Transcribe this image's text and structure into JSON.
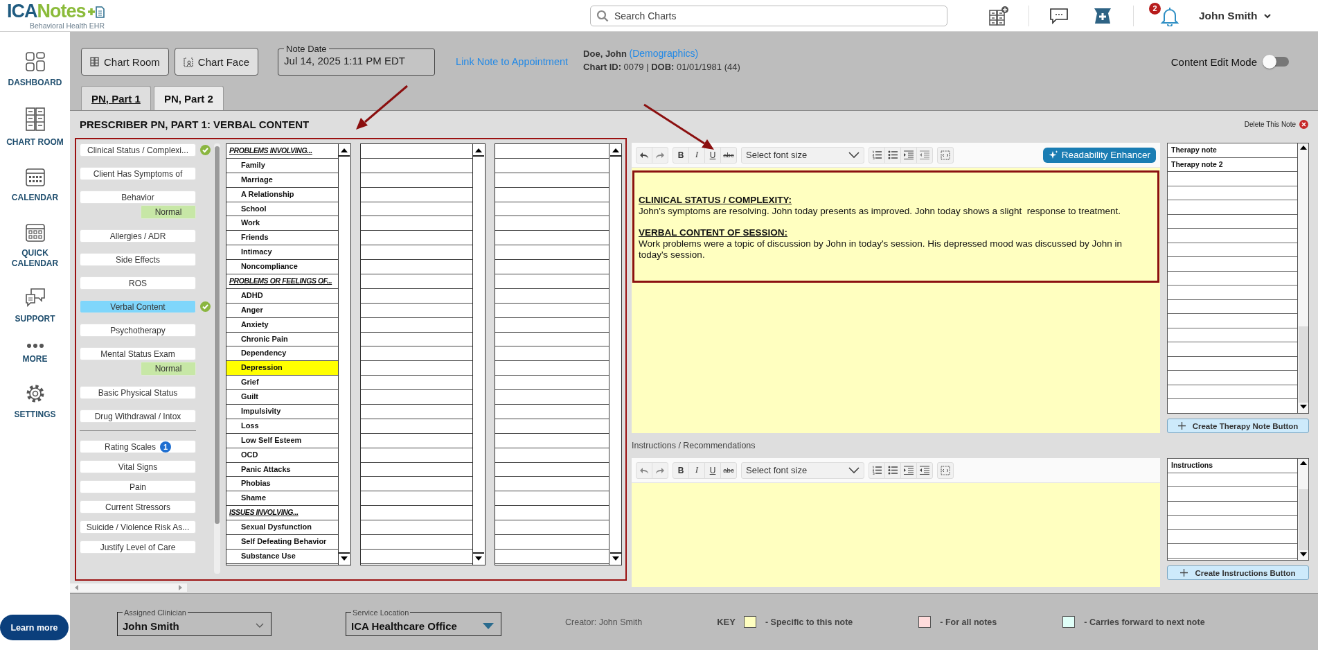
{
  "header": {
    "logo_part_1": "ICA",
    "logo_part_2": "Notes",
    "tagline": "Behavioral Health EHR",
    "search_placeholder": "Search Charts",
    "notification_count": "2",
    "user_name": "John Smith"
  },
  "nav": [
    {
      "label": "DASHBOARD",
      "kind": "dashboard"
    },
    {
      "label": "CHART ROOM",
      "kind": "chartroom"
    },
    {
      "label": "CALENDAR",
      "kind": "calendar"
    },
    {
      "label": "QUICK CALENDAR",
      "kind": "quickcalendar"
    },
    {
      "label": "SUPPORT",
      "kind": "support"
    },
    {
      "label": "MORE",
      "kind": "more"
    },
    {
      "label": "SETTINGS",
      "kind": "settings"
    }
  ],
  "learn_more": "Learn more",
  "toolbar": {
    "buttons": [
      {
        "label": "Chart Room",
        "kind": "chartroom"
      },
      {
        "label": "Chart Face",
        "kind": "chartface"
      }
    ],
    "note_date": {
      "label": "Note Date",
      "value": "Jul 14, 2025 1:11 PM EDT"
    },
    "link": "Link Note to Appointment",
    "patient": {
      "name": "Doe, John",
      "demographics": "(Demographics)",
      "chart_id_label": "Chart ID:",
      "chart_id": "0079",
      "separator": "|",
      "dob_label": "DOB:",
      "dob": "01/01/1981 (44)"
    },
    "content_edit_mode": {
      "label": "Content Edit Mode",
      "on": false
    }
  },
  "tabs": [
    {
      "label": "PN, Part 1",
      "selected": true
    },
    {
      "label": "PN, Part 2",
      "selected": false
    }
  ],
  "section_title": "PRESCRIBER PN, PART 1: VERBAL CONTENT",
  "delete_note": "Delete This Note",
  "sections": [
    {
      "label": "Clinical Status / Complexi...",
      "selected": false,
      "completed": true
    },
    {
      "label": "Client Has Symptoms of",
      "selected": false,
      "completed": false
    },
    {
      "label": "Behavior",
      "selected": false,
      "completed": false,
      "status": "Normal"
    },
    {
      "label": "Allergies / ADR",
      "selected": false,
      "completed": false
    },
    {
      "label": "Side Effects",
      "selected": false,
      "completed": false
    },
    {
      "label": "ROS",
      "selected": false,
      "completed": false
    },
    {
      "label": "Verbal Content",
      "selected": true,
      "completed": true
    },
    {
      "label": "Psychotherapy",
      "selected": false,
      "completed": false
    },
    {
      "label": "Mental Status Exam",
      "selected": false,
      "completed": false,
      "status": "Normal"
    },
    {
      "label": "Basic Physical Status",
      "selected": false,
      "completed": false
    },
    {
      "label": "Drug Withdrawal / Intox",
      "selected": false,
      "completed": false
    }
  ],
  "sections_more": [
    {
      "label": "Rating Scales",
      "selected": false,
      "completed": false,
      "badge": "1"
    },
    {
      "label": "Vital Signs",
      "selected": false,
      "completed": false
    },
    {
      "label": "Pain",
      "selected": false,
      "completed": false
    },
    {
      "label": "Current Stressors",
      "selected": false,
      "completed": false
    },
    {
      "label": "Suicide / Violence Risk As...",
      "selected": false,
      "completed": false
    },
    {
      "label": "Justify Level of Care",
      "selected": false,
      "completed": false
    }
  ],
  "problem_list": [
    {
      "label": "PROBLEMS INVOLVING...",
      "kind": "heading",
      "selected": false
    },
    {
      "label": "Family",
      "kind": "item",
      "selected": false
    },
    {
      "label": "Marriage",
      "kind": "item",
      "selected": false
    },
    {
      "label": "A Relationship",
      "kind": "item",
      "selected": false
    },
    {
      "label": "School",
      "kind": "item",
      "selected": false
    },
    {
      "label": "Work",
      "kind": "item",
      "selected": false
    },
    {
      "label": "Friends",
      "kind": "item",
      "selected": false
    },
    {
      "label": "Intimacy",
      "kind": "item",
      "selected": false
    },
    {
      "label": "Noncompliance",
      "kind": "item",
      "selected": false
    },
    {
      "label": "PROBLEMS OR FEELINGS OF...",
      "kind": "heading",
      "selected": false
    },
    {
      "label": "ADHD",
      "kind": "item",
      "selected": false
    },
    {
      "label": "Anger",
      "kind": "item",
      "selected": false
    },
    {
      "label": "Anxiety",
      "kind": "item",
      "selected": false
    },
    {
      "label": "Chronic Pain",
      "kind": "item",
      "selected": false
    },
    {
      "label": "Dependency",
      "kind": "item",
      "selected": false
    },
    {
      "label": "Depression",
      "kind": "item",
      "selected": true
    },
    {
      "label": "Grief",
      "kind": "item",
      "selected": false
    },
    {
      "label": "Guilt",
      "kind": "item",
      "selected": false
    },
    {
      "label": "Impulsivity",
      "kind": "item",
      "selected": false
    },
    {
      "label": "Loss",
      "kind": "item",
      "selected": false
    },
    {
      "label": "Low Self Esteem",
      "kind": "item",
      "selected": false
    },
    {
      "label": "OCD",
      "kind": "item",
      "selected": false
    },
    {
      "label": "Panic Attacks",
      "kind": "item",
      "selected": false
    },
    {
      "label": "Phobias",
      "kind": "item",
      "selected": false
    },
    {
      "label": "Shame",
      "kind": "item",
      "selected": false
    },
    {
      "label": "ISSUES INVOLVING...",
      "kind": "heading",
      "selected": false
    },
    {
      "label": "Sexual Dysfunction",
      "kind": "item",
      "selected": false
    },
    {
      "label": "Self Defeating Behavior",
      "kind": "item",
      "selected": false
    },
    {
      "label": "Substance Use",
      "kind": "item",
      "selected": false
    }
  ],
  "editor": {
    "format_buttons": [
      "B",
      "I",
      "U",
      "abc"
    ],
    "font_size_placeholder": "Select font size",
    "readability_button": "Readability Enhancer",
    "content": [
      {
        "heading": "CLINICAL STATUS / COMPLEXITY:",
        "text": "John's symptoms are resolving. John today presents as improved. John today shows a slight  response to treatment."
      },
      {
        "heading": "VERBAL CONTENT OF SESSION:",
        "text": "Work problems were a topic of discussion by John in today's session. His depressed mood was discussed by John in today's session."
      }
    ]
  },
  "therapy_notes": {
    "items": [
      "Therapy note",
      "Therapy note 2"
    ],
    "button": "Create Therapy Note Button"
  },
  "instructions": {
    "label": "Instructions / Recommendations",
    "format_buttons": [
      "B",
      "I",
      "U",
      "abc"
    ],
    "font_size_placeholder": "Select font size",
    "list_header": "Instructions",
    "button": "Create Instructions Button"
  },
  "footer": {
    "assigned_clinician": {
      "label": "Assigned Clinician",
      "value": "John Smith"
    },
    "service_location": {
      "label": "Service Location",
      "value": "ICA Healthcare Office"
    },
    "creator": "Creator: John Smith",
    "key_label": "KEY",
    "key": [
      {
        "label": "- Specific to this note",
        "color": "#ffffc0"
      },
      {
        "label": "- For all notes",
        "color": "#ffdcdc"
      },
      {
        "label": "- Carries forward to next note",
        "color": "#e0fff8"
      }
    ]
  }
}
